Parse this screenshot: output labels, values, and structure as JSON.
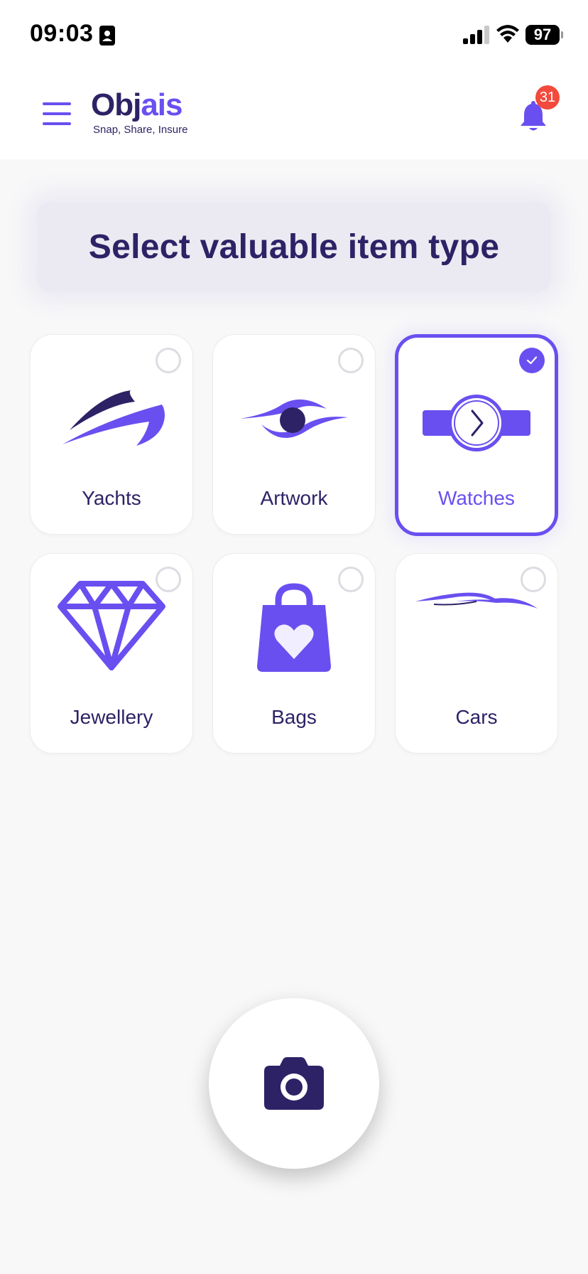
{
  "status_bar": {
    "time": "09:03",
    "battery": "97"
  },
  "header": {
    "logo_text_dark": "Obj",
    "logo_text_accent": "ais",
    "tagline": "Snap, Share, Insure",
    "notification_count": "31"
  },
  "page": {
    "title": "Select valuable item type"
  },
  "categories": [
    {
      "label": "Yachts",
      "icon": "yacht-icon",
      "selected": false
    },
    {
      "label": "Artwork",
      "icon": "eye-icon",
      "selected": false
    },
    {
      "label": "Watches",
      "icon": "watch-icon",
      "selected": true
    },
    {
      "label": "Jewellery",
      "icon": "diamond-icon",
      "selected": false
    },
    {
      "label": "Bags",
      "icon": "shopping-bag-heart-icon",
      "selected": false
    },
    {
      "label": "Cars",
      "icon": "car-icon",
      "selected": false
    }
  ],
  "colors": {
    "accent": "#6a4ff0",
    "primary_dark": "#2e2266",
    "badge": "#f24a3c",
    "background": "#f8f8f9"
  }
}
